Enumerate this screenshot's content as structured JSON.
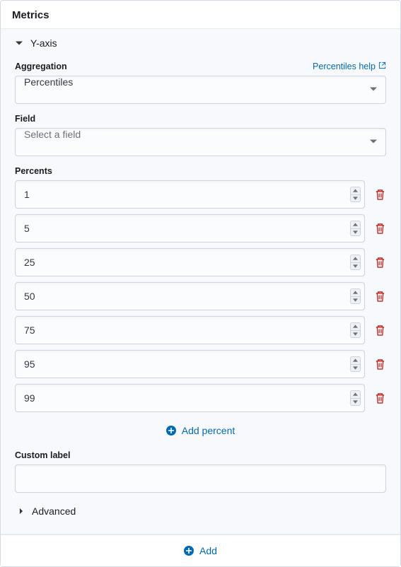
{
  "panel": {
    "title": "Metrics"
  },
  "accordion": {
    "label": "Y-axis"
  },
  "aggregation": {
    "label": "Aggregation",
    "help_text": "Percentiles help",
    "value": "Percentiles"
  },
  "field": {
    "label": "Field",
    "placeholder": "Select a field",
    "value": ""
  },
  "percents": {
    "label": "Percents",
    "values": [
      "1",
      "5",
      "25",
      "50",
      "75",
      "95",
      "99"
    ],
    "add_label": "Add percent"
  },
  "custom_label": {
    "label": "Custom label",
    "value": ""
  },
  "advanced": {
    "label": "Advanced"
  },
  "footer": {
    "add_label": "Add"
  }
}
